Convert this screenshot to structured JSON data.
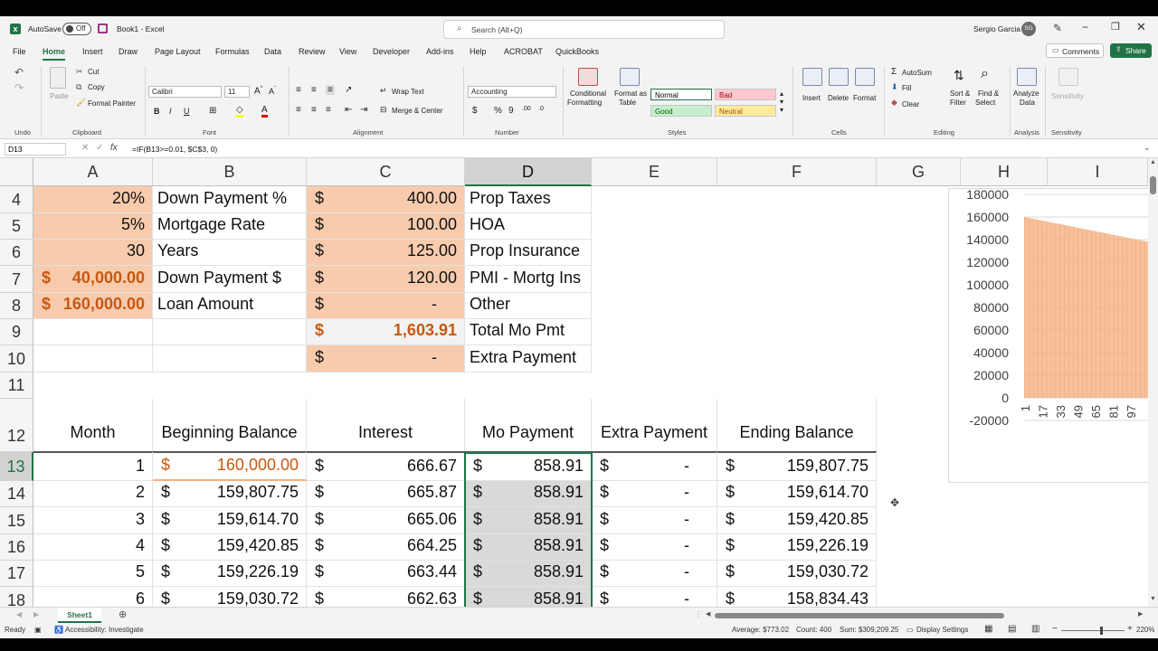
{
  "titlebar": {
    "autosave": "AutoSave",
    "toggle": "Off",
    "doc": "Book1 - Excel",
    "search": "Search (Alt+Q)",
    "user": "Sergio Garcia",
    "initials": "SG"
  },
  "tabs": [
    "File",
    "Home",
    "Insert",
    "Draw",
    "Page Layout",
    "Formulas",
    "Data",
    "Review",
    "View",
    "Developer",
    "Add-ins",
    "Help",
    "ACROBAT",
    "QuickBooks"
  ],
  "ribbon": {
    "comments": "Comments",
    "share": "Share",
    "groups": {
      "undo": "Undo",
      "clipboard": "Clipboard",
      "font": "Font",
      "alignment": "Alignment",
      "number": "Number",
      "styles": "Styles",
      "cells": "Cells",
      "editing": "Editing",
      "analysis": "Analysis",
      "sensitivity": "Sensitivity"
    },
    "paste": "Paste",
    "cut": "Cut",
    "copy": "Copy",
    "format_painter": "Format Painter",
    "font_name": "Calibri",
    "font_size": "11",
    "wrap": "Wrap Text",
    "merge": "Merge & Center",
    "number_format": "Accounting",
    "cond": [
      "Conditional",
      "Formatting"
    ],
    "format_table": [
      "Format as",
      "Table"
    ],
    "styles": {
      "normal": "Normal",
      "bad": "Bad",
      "good": "Good",
      "neutral": "Neutral"
    },
    "insert": "Insert",
    "delete": "Delete",
    "format": "Format",
    "autosum": "AutoSum",
    "fill": "Fill",
    "clear": "Clear",
    "sort": [
      "Sort &",
      "Filter"
    ],
    "find": [
      "Find &",
      "Select"
    ],
    "analyze": [
      "Analyze",
      "Data"
    ],
    "sens": "Sensitivity"
  },
  "formula": {
    "namebox": "D13",
    "fx": "fx",
    "content": "=IF(B13>=0.01, $C$3, 0)"
  },
  "columns": [
    "A",
    "B",
    "C",
    "D",
    "E",
    "F",
    "G",
    "H",
    "I"
  ],
  "rows": {
    "r4": {
      "num": "4",
      "a": "20%",
      "b": "Down Payment %",
      "c_sym": "$",
      "c": "400.00",
      "d": "Prop Taxes"
    },
    "r5": {
      "num": "5",
      "a": "5%",
      "b": "Mortgage Rate",
      "c_sym": "$",
      "c": "100.00",
      "d": "HOA"
    },
    "r6": {
      "num": "6",
      "a": "30",
      "b": "Years",
      "c_sym": "$",
      "c": "125.00",
      "d": "Prop Insurance"
    },
    "r7": {
      "num": "7",
      "a_sym": "$",
      "a": "40,000.00",
      "b": "Down Payment $",
      "c_sym": "$",
      "c": "120.00",
      "d": "PMI - Mortg Ins"
    },
    "r8": {
      "num": "8",
      "a_sym": "$",
      "a": "160,000.00",
      "b": "Loan Amount",
      "c_sym": "$",
      "c": "-",
      "d": "Other"
    },
    "r9": {
      "num": "9",
      "c_sym": "$",
      "c": "1,603.91",
      "d": "Total Mo Pmt"
    },
    "r10": {
      "num": "10",
      "c_sym": "$",
      "c": "-",
      "d": "Extra Payment"
    },
    "r11": {
      "num": "11"
    },
    "r12": {
      "num": "12",
      "a": "Month",
      "b": "Beginning Balance",
      "c": "Interest",
      "d": "Mo Payment",
      "e": "Extra Payment",
      "f": "Ending Balance"
    }
  },
  "table": [
    {
      "num": "13",
      "m": "1",
      "b": "160,000.00",
      "c": "666.67",
      "d": "858.91",
      "e": "-",
      "f": "159,807.75"
    },
    {
      "num": "14",
      "m": "2",
      "b": "159,807.75",
      "c": "665.87",
      "d": "858.91",
      "e": "-",
      "f": "159,614.70"
    },
    {
      "num": "15",
      "m": "3",
      "b": "159,614.70",
      "c": "665.06",
      "d": "858.91",
      "e": "-",
      "f": "159,420.85"
    },
    {
      "num": "16",
      "m": "4",
      "b": "159,420.85",
      "c": "664.25",
      "d": "858.91",
      "e": "-",
      "f": "159,226.19"
    },
    {
      "num": "17",
      "m": "5",
      "b": "159,226.19",
      "c": "663.44",
      "d": "858.91",
      "e": "-",
      "f": "159,030.72"
    },
    {
      "num": "18",
      "m": "6",
      "b": "159,030.72",
      "c": "662.63",
      "d": "858.91",
      "e": "-",
      "f": "158,834.43"
    }
  ],
  "dollar": "$",
  "chart_data": {
    "type": "bar",
    "y_ticks": [
      "180000",
      "160000",
      "140000",
      "120000",
      "100000",
      "80000",
      "60000",
      "40000",
      "20000",
      "0",
      "-20000"
    ],
    "ylim": [
      -20000,
      180000
    ],
    "x_ticks": [
      "1",
      "17",
      "33",
      "49",
      "65",
      "81",
      "97"
    ],
    "start_value": 160000,
    "end_value": 138000,
    "color": "#f4b183"
  },
  "sheet": {
    "name": "Sheet1"
  },
  "status": {
    "ready": "Ready",
    "accessibility": "Accessibility: Investigate",
    "average": "Average: $773.02",
    "count": "Count: 400",
    "sum": "Sum: $309,209.25",
    "display": "Display Settings",
    "zoom": "220%"
  }
}
